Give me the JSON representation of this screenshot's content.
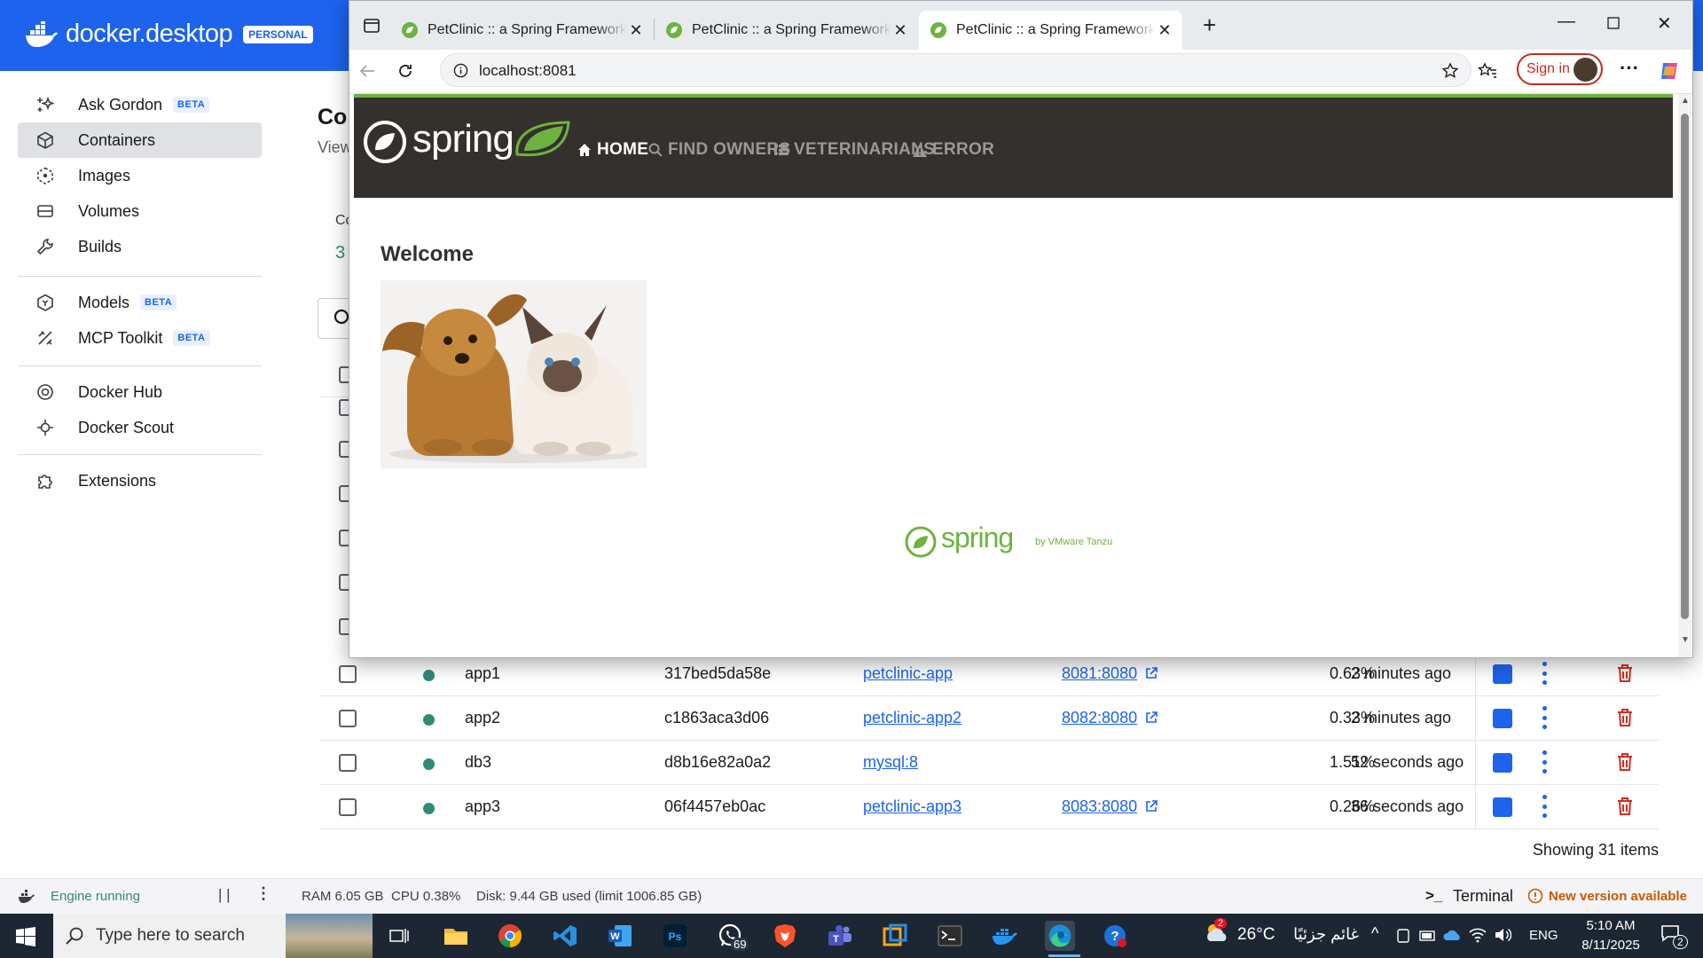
{
  "docker": {
    "app_name": "docker.desktop",
    "plan_badge": "PERSONAL",
    "sidebar": {
      "items": [
        {
          "label": "Ask Gordon",
          "beta": "BETA"
        },
        {
          "label": "Containers"
        },
        {
          "label": "Images"
        },
        {
          "label": "Volumes"
        },
        {
          "label": "Builds"
        },
        {
          "label": "Models",
          "beta": "BETA"
        },
        {
          "label": "MCP Toolkit",
          "beta": "BETA"
        },
        {
          "label": "Docker Hub"
        },
        {
          "label": "Docker Scout"
        },
        {
          "label": "Extensions"
        }
      ]
    },
    "main": {
      "title_peek": "Co",
      "subtitle_peek": "View",
      "stat_label_peek": "Co",
      "stat_value_peek": "3"
    },
    "containers": [
      {
        "name": "app1",
        "id": "317bed5da58e",
        "image": "petclinic-app",
        "ports": "8081:8080",
        "cpu": "0.63%",
        "last_started": "2 minutes ago"
      },
      {
        "name": "app2",
        "id": "c1863aca3d06",
        "image": "petclinic-app2",
        "ports": "8082:8080",
        "cpu": "0.33%",
        "last_started": "2 minutes ago"
      },
      {
        "name": "db3",
        "id": "d8b16e82a0a2",
        "image": "mysql:8",
        "ports": "",
        "cpu": "1.51%",
        "last_started": "52 seconds ago"
      },
      {
        "name": "app3",
        "id": "06f4457eb0ac",
        "image": "petclinic-app3",
        "ports": "8083:8080",
        "cpu": "0.26%",
        "last_started": "36 seconds ago"
      }
    ],
    "showing": "Showing 31 items",
    "footer": {
      "engine": "Engine running",
      "ram": "RAM 6.05 GB",
      "cpu": "CPU 0.38%",
      "disk": "Disk: 9.44 GB used (limit 1006.85 GB)",
      "terminal": "Terminal",
      "update": "New version available"
    }
  },
  "browser": {
    "tabs": [
      {
        "title": "PetClinic :: a Spring Framework demonstration"
      },
      {
        "title": "PetClinic :: a Spring Framework demonstration"
      },
      {
        "title": "PetClinic :: a Spring Framework demonstration"
      }
    ],
    "url": "localhost:8081",
    "sign_in": "Sign in"
  },
  "petclinic": {
    "brand": "spring",
    "nav": [
      "HOME",
      "FIND OWNERS",
      "VETERINARIANS",
      "ERROR"
    ],
    "welcome": "Welcome",
    "footer_brand": "spring",
    "footer_by": "by VMware Tanzu"
  },
  "taskbar": {
    "search_placeholder": "Type here to search",
    "whatsapp_badge": "69",
    "weather_temp": "26°C",
    "weather_text": "غائم جزئيًا",
    "weather_badge": "2",
    "lang": "ENG",
    "time": "5:10 AM",
    "date": "8/11/2025",
    "notif_count": "2"
  },
  "colors": {
    "docker_blue": "#1d63ed",
    "spring_green": "#6db33f",
    "spring_dark": "#34302d",
    "running_green": "#2e8b76"
  }
}
